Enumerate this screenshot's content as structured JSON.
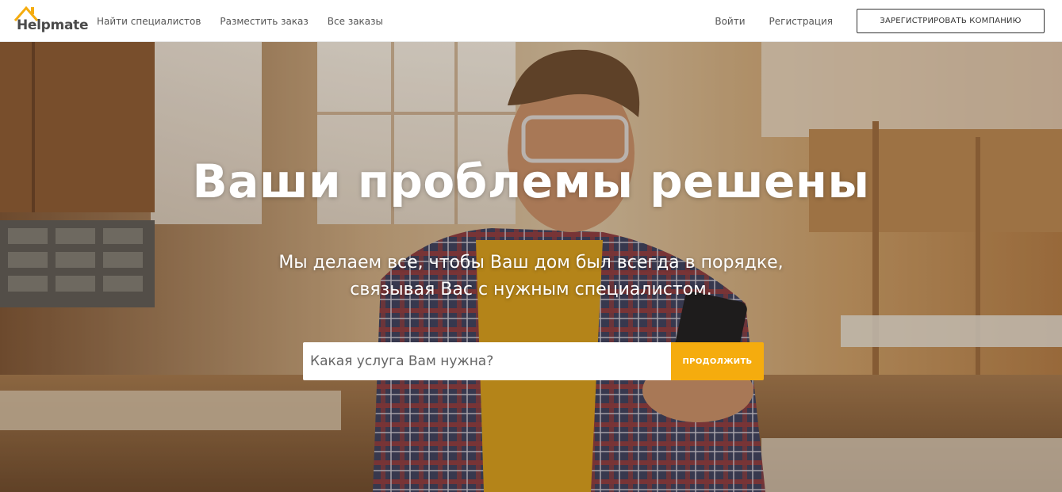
{
  "brand": {
    "name": "Helpmate",
    "accent": "#f5ac0e"
  },
  "nav": {
    "left": [
      {
        "label": "Найти специалистов"
      },
      {
        "label": "Разместить заказ"
      },
      {
        "label": "Все заказы"
      }
    ],
    "login": "Войти",
    "register": "Регистрация",
    "register_company": "ЗАРЕГИСТРИРОВАТЬ КОМПАНИЮ"
  },
  "hero": {
    "title": "Ваши проблемы решены",
    "subtitle_line1": "Мы делаем все, чтобы Ваш дом был всегда в порядке,",
    "subtitle_line2": "связывая Вас с нужным специалистом.",
    "search": {
      "placeholder": "Какая услуга Вам нужна?",
      "value": ""
    },
    "continue_label": "ПРОДОЛЖИТЬ"
  },
  "icons": {
    "logo": "house-roof-icon"
  }
}
